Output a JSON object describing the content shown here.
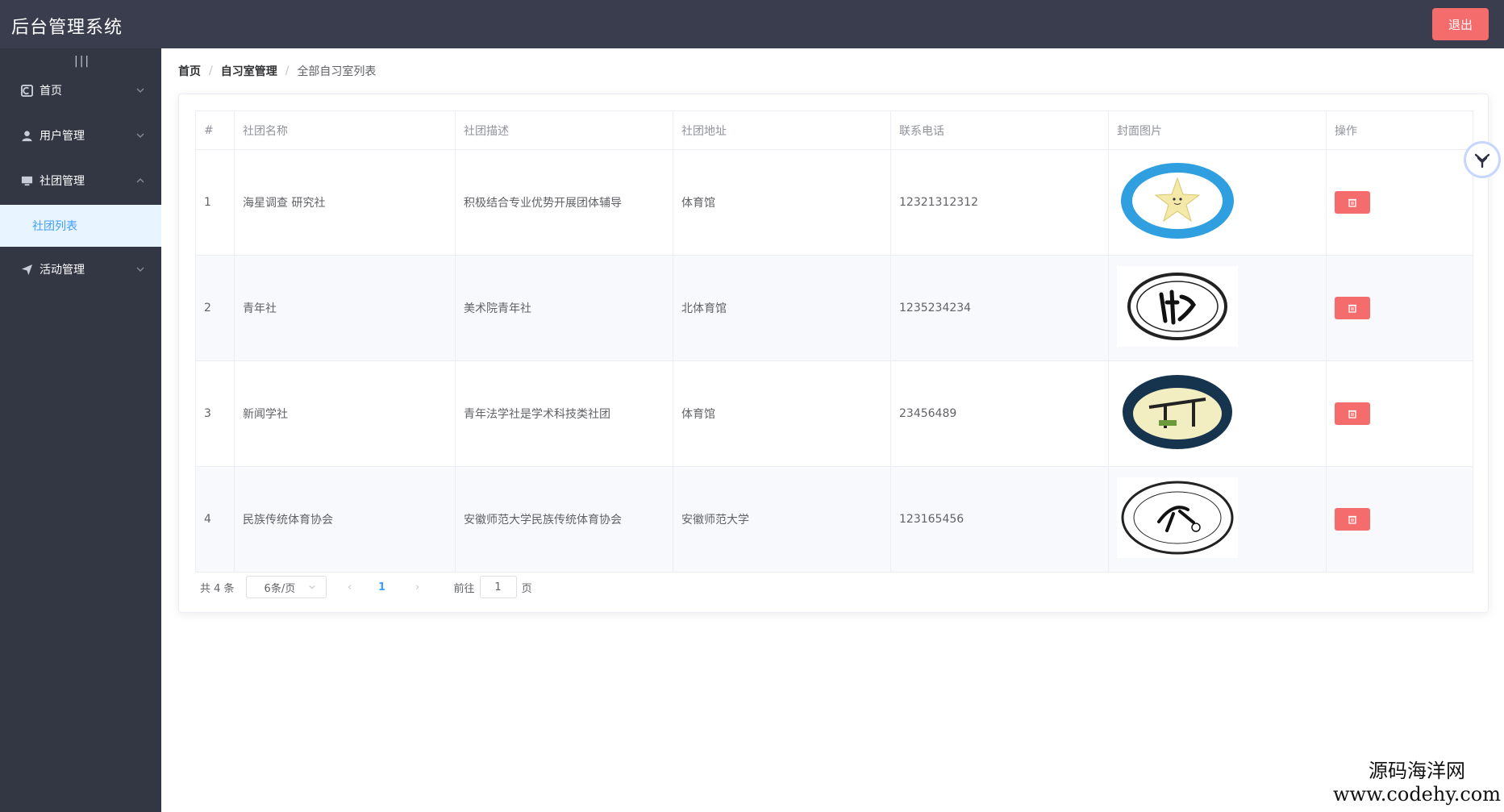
{
  "header": {
    "title": "后台管理系统",
    "logout_label": "退出"
  },
  "sidebar": {
    "toggle": "|||",
    "items": [
      {
        "label": "首页",
        "icon": "home-icon"
      },
      {
        "label": "用户管理",
        "icon": "user-icon"
      },
      {
        "label": "社团管理",
        "icon": "monitor-icon"
      },
      {
        "label": "活动管理",
        "icon": "send-icon"
      }
    ],
    "submenu_active": "社团列表"
  },
  "breadcrumb": {
    "home": "首页",
    "parent": "自习室管理",
    "current": "全部自习室列表",
    "sep": "/"
  },
  "table": {
    "headers": [
      "#",
      "社团名称",
      "社团描述",
      "社团地址",
      "联系电话",
      "封面图片",
      "操作"
    ],
    "rows": [
      {
        "index": "1",
        "name": "海星调查 研究社",
        "desc": "积极结合专业优势开展团体辅导",
        "addr": "体育馆",
        "phone": "12321312312"
      },
      {
        "index": "2",
        "name": "青年社",
        "desc": "美术院青年社",
        "addr": "北体育馆",
        "phone": "1235234234"
      },
      {
        "index": "3",
        "name": "新闻学社",
        "desc": "青年法学社是学术科技类社团",
        "addr": "体育馆",
        "phone": "23456489"
      },
      {
        "index": "4",
        "name": "民族传统体育协会",
        "desc": "安徽师范大学民族传统体育协会",
        "addr": "安徽师范大学",
        "phone": "123165456"
      }
    ]
  },
  "pagination": {
    "total": "共 4 条",
    "page_size": "6条/页",
    "current_page": "1",
    "goto_label": "前往",
    "goto_value": "1",
    "page_unit": "页",
    "prev": "‹",
    "next": "›"
  },
  "watermark": {
    "line1": "源码海洋网",
    "line2": "www.codehy.com"
  },
  "colors": {
    "header_bg": "#3a3d4d",
    "sidebar_bg": "#333744",
    "accent": "#409eff",
    "danger": "#f56c6c"
  }
}
